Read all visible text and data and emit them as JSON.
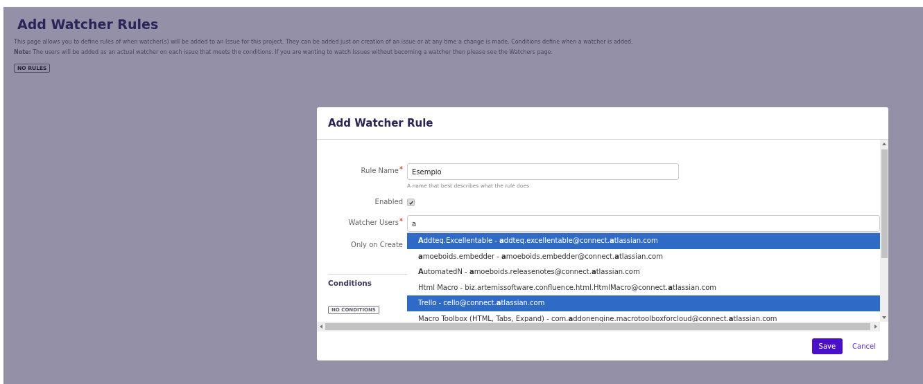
{
  "page": {
    "title": "Add Watcher Rules",
    "description": "This page allows you to define rules of when watcher(s) will be added to an Issue for this project. They can be added just on creation of an issue or at any time a change is made. Conditions define when a watcher is added.",
    "note": "**Note:** The users will be added as an actual watcher on each issue that meets the conditions. If you are wanting to watch Issues without becoming a watcher then please see the Watchers page.",
    "rules_tag": "NO RULES"
  },
  "dialog": {
    "title": "Add Watcher Rule",
    "fields": [
      {
        "kind": "text",
        "label": "Rule Name",
        "required": true,
        "value": "Esempio",
        "hint": "A name that best describes what the rule does"
      },
      {
        "kind": "checkbox",
        "label": "Enabled",
        "required": false,
        "checked": true
      },
      {
        "kind": "text",
        "label": "Watcher Users",
        "required": true,
        "value": "a"
      },
      {
        "kind": "label",
        "label": "Only on Create",
        "required": false
      }
    ],
    "suggestions": [
      {
        "text": "**A**ddteq.Excellentable - **a**ddteq.excellentable@connect.**a**tlassian.com",
        "selected": true
      },
      {
        "text": "**a**moeboids.embedder - **a**moeboids.embedder@connect.**a**tlassian.com",
        "selected": false
      },
      {
        "text": "**A**utomatedN - **a**moeboids.releasenotes@connect.**a**tlassian.com",
        "selected": false
      },
      {
        "text": "Html Macro - biz.artemissoftware.confluence.html.HtmlMacro@connect.**a**tlassian.com",
        "selected": false
      },
      {
        "text": "Trello - cello@connect.**a**tlassian.com",
        "selected": true
      },
      {
        "text": "Macro Toolbox (HTML, Tabs, Expand) - com.**a**ddonengine.macrotoolboxforcloud@connect.**a**tlassian.com",
        "selected": false
      }
    ],
    "conditions_heading": "Conditions",
    "conditions_tag": "NO CONDITIONS",
    "buttons": [
      {
        "kind": "primary",
        "label": "Save"
      },
      {
        "kind": "link",
        "label": "Cancel"
      }
    ]
  }
}
